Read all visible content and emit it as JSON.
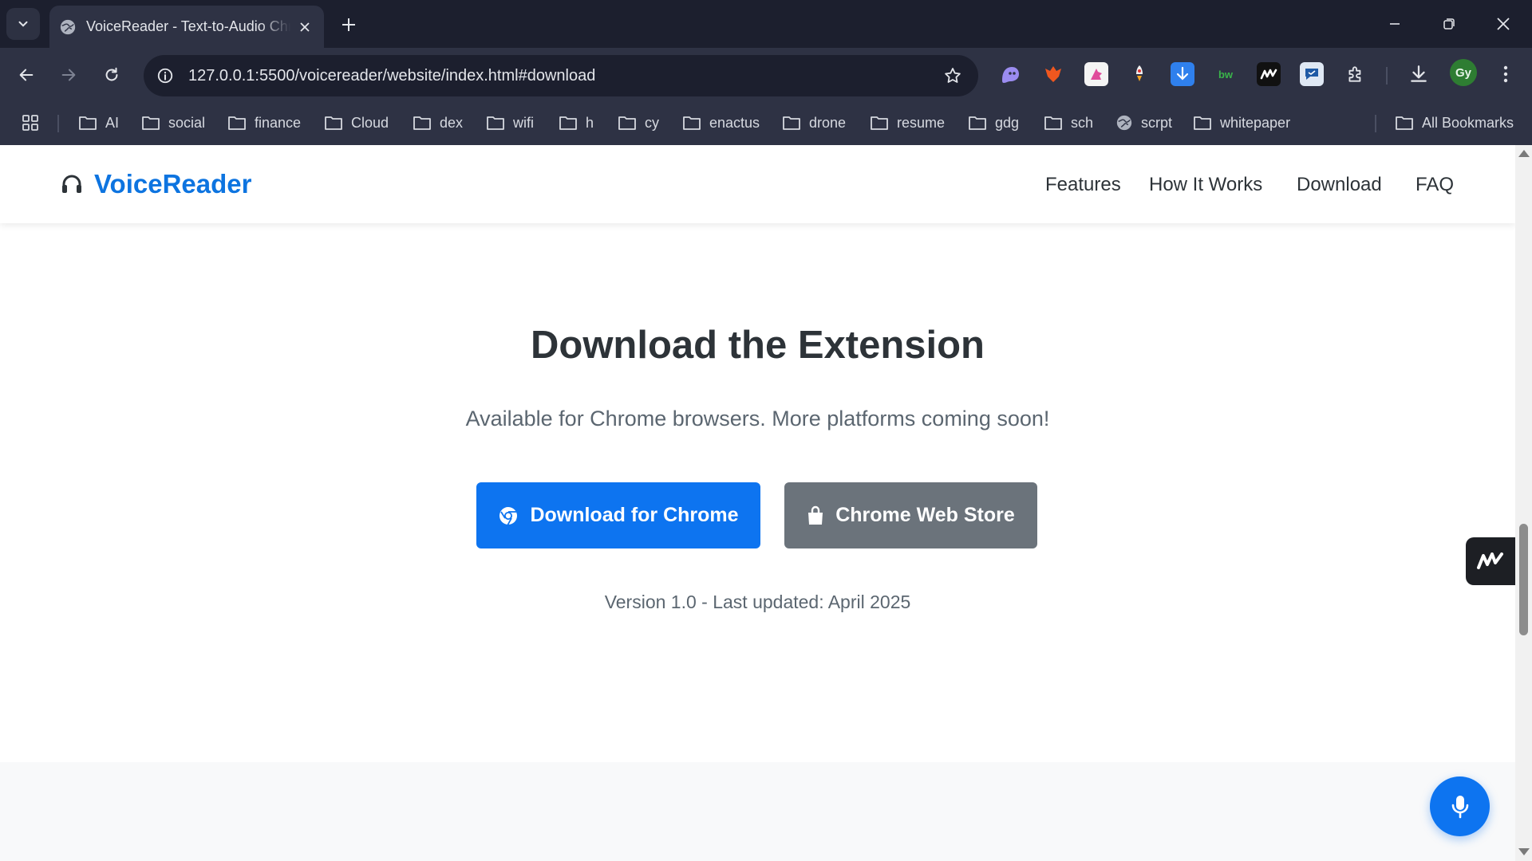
{
  "browser": {
    "tab_title": "VoiceReader - Text-to-Audio Chrome Extension",
    "url": "127.0.0.1:5500/voicereader/website/index.html#download",
    "profile_initials": "Gy",
    "bookmarks": [
      "AI",
      "social",
      "finance",
      "Cloud",
      "dex",
      "wifi",
      "h",
      "cy",
      "enactus",
      "drone",
      "resume",
      "gdg",
      "sch",
      "scrpt",
      "whitepaper"
    ],
    "all_bookmarks_label": "All Bookmarks",
    "extensions": [
      "ghost-icon",
      "fox-icon",
      "unicorn-icon",
      "rocket-icon",
      "download-arrow-icon",
      "bw-icon",
      "m-logo-icon",
      "chat-icon"
    ],
    "ext_bw_label": "bw",
    "colors": {
      "tabbar": "#1c1f2e",
      "toolbar": "#2e3244"
    }
  },
  "site": {
    "brand": "VoiceReader",
    "nav": [
      "Features",
      "How It Works",
      "Download",
      "FAQ"
    ],
    "download": {
      "title": "Download the Extension",
      "subtitle": "Available for Chrome browsers. More platforms coming soon!",
      "primary_button": "Download for Chrome",
      "secondary_button": "Chrome Web Store",
      "version": "Version 1.0 - Last updated: April 2025"
    },
    "colors": {
      "brand": "#0d74e0",
      "primary": "#0d74f0",
      "secondary": "#6b737b",
      "text": "#2d3338",
      "muted": "#5b6670"
    }
  }
}
